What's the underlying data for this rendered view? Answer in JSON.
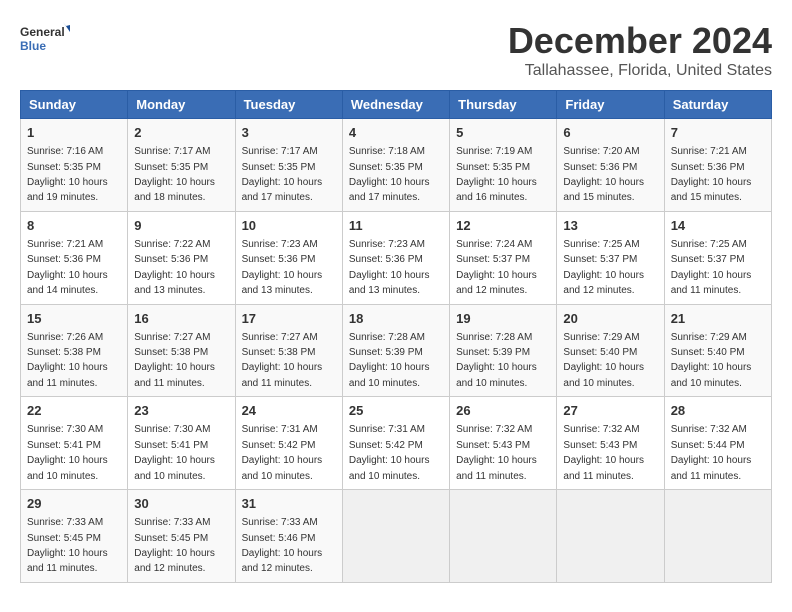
{
  "logo": {
    "line1": "General",
    "line2": "Blue"
  },
  "title": "December 2024",
  "location": "Tallahassee, Florida, United States",
  "weekdays": [
    "Sunday",
    "Monday",
    "Tuesday",
    "Wednesday",
    "Thursday",
    "Friday",
    "Saturday"
  ],
  "weeks": [
    [
      {
        "day": "1",
        "sunrise": "7:16 AM",
        "sunset": "5:35 PM",
        "daylight": "10 hours and 19 minutes."
      },
      {
        "day": "2",
        "sunrise": "7:17 AM",
        "sunset": "5:35 PM",
        "daylight": "10 hours and 18 minutes."
      },
      {
        "day": "3",
        "sunrise": "7:17 AM",
        "sunset": "5:35 PM",
        "daylight": "10 hours and 17 minutes."
      },
      {
        "day": "4",
        "sunrise": "7:18 AM",
        "sunset": "5:35 PM",
        "daylight": "10 hours and 17 minutes."
      },
      {
        "day": "5",
        "sunrise": "7:19 AM",
        "sunset": "5:35 PM",
        "daylight": "10 hours and 16 minutes."
      },
      {
        "day": "6",
        "sunrise": "7:20 AM",
        "sunset": "5:36 PM",
        "daylight": "10 hours and 15 minutes."
      },
      {
        "day": "7",
        "sunrise": "7:21 AM",
        "sunset": "5:36 PM",
        "daylight": "10 hours and 15 minutes."
      }
    ],
    [
      {
        "day": "8",
        "sunrise": "7:21 AM",
        "sunset": "5:36 PM",
        "daylight": "10 hours and 14 minutes."
      },
      {
        "day": "9",
        "sunrise": "7:22 AM",
        "sunset": "5:36 PM",
        "daylight": "10 hours and 13 minutes."
      },
      {
        "day": "10",
        "sunrise": "7:23 AM",
        "sunset": "5:36 PM",
        "daylight": "10 hours and 13 minutes."
      },
      {
        "day": "11",
        "sunrise": "7:23 AM",
        "sunset": "5:36 PM",
        "daylight": "10 hours and 13 minutes."
      },
      {
        "day": "12",
        "sunrise": "7:24 AM",
        "sunset": "5:37 PM",
        "daylight": "10 hours and 12 minutes."
      },
      {
        "day": "13",
        "sunrise": "7:25 AM",
        "sunset": "5:37 PM",
        "daylight": "10 hours and 12 minutes."
      },
      {
        "day": "14",
        "sunrise": "7:25 AM",
        "sunset": "5:37 PM",
        "daylight": "10 hours and 11 minutes."
      }
    ],
    [
      {
        "day": "15",
        "sunrise": "7:26 AM",
        "sunset": "5:38 PM",
        "daylight": "10 hours and 11 minutes."
      },
      {
        "day": "16",
        "sunrise": "7:27 AM",
        "sunset": "5:38 PM",
        "daylight": "10 hours and 11 minutes."
      },
      {
        "day": "17",
        "sunrise": "7:27 AM",
        "sunset": "5:38 PM",
        "daylight": "10 hours and 11 minutes."
      },
      {
        "day": "18",
        "sunrise": "7:28 AM",
        "sunset": "5:39 PM",
        "daylight": "10 hours and 10 minutes."
      },
      {
        "day": "19",
        "sunrise": "7:28 AM",
        "sunset": "5:39 PM",
        "daylight": "10 hours and 10 minutes."
      },
      {
        "day": "20",
        "sunrise": "7:29 AM",
        "sunset": "5:40 PM",
        "daylight": "10 hours and 10 minutes."
      },
      {
        "day": "21",
        "sunrise": "7:29 AM",
        "sunset": "5:40 PM",
        "daylight": "10 hours and 10 minutes."
      }
    ],
    [
      {
        "day": "22",
        "sunrise": "7:30 AM",
        "sunset": "5:41 PM",
        "daylight": "10 hours and 10 minutes."
      },
      {
        "day": "23",
        "sunrise": "7:30 AM",
        "sunset": "5:41 PM",
        "daylight": "10 hours and 10 minutes."
      },
      {
        "day": "24",
        "sunrise": "7:31 AM",
        "sunset": "5:42 PM",
        "daylight": "10 hours and 10 minutes."
      },
      {
        "day": "25",
        "sunrise": "7:31 AM",
        "sunset": "5:42 PM",
        "daylight": "10 hours and 10 minutes."
      },
      {
        "day": "26",
        "sunrise": "7:32 AM",
        "sunset": "5:43 PM",
        "daylight": "10 hours and 11 minutes."
      },
      {
        "day": "27",
        "sunrise": "7:32 AM",
        "sunset": "5:43 PM",
        "daylight": "10 hours and 11 minutes."
      },
      {
        "day": "28",
        "sunrise": "7:32 AM",
        "sunset": "5:44 PM",
        "daylight": "10 hours and 11 minutes."
      }
    ],
    [
      {
        "day": "29",
        "sunrise": "7:33 AM",
        "sunset": "5:45 PM",
        "daylight": "10 hours and 11 minutes."
      },
      {
        "day": "30",
        "sunrise": "7:33 AM",
        "sunset": "5:45 PM",
        "daylight": "10 hours and 12 minutes."
      },
      {
        "day": "31",
        "sunrise": "7:33 AM",
        "sunset": "5:46 PM",
        "daylight": "10 hours and 12 minutes."
      },
      null,
      null,
      null,
      null
    ]
  ]
}
